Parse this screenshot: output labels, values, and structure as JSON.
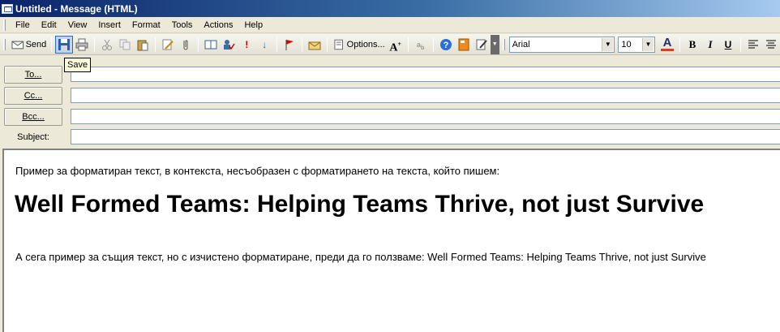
{
  "window": {
    "title": "Untitled - Message (HTML)"
  },
  "menu": [
    "File",
    "Edit",
    "View",
    "Insert",
    "Format",
    "Tools",
    "Actions",
    "Help"
  ],
  "toolbar": {
    "send_label": "Send",
    "options_label": "Options...",
    "font_name": "Arial",
    "font_size": "10",
    "bold": "B",
    "italic": "I",
    "underline": "U"
  },
  "tooltip": {
    "text": "Save"
  },
  "header": {
    "to_label": "To...",
    "cc_label": "Cc...",
    "bcc_label": "Bcc...",
    "subject_label": "Subject:",
    "to_value": "",
    "cc_value": "",
    "bcc_value": "",
    "subject_value": ""
  },
  "body": {
    "line1": "Пример за форматиран текст, в контекста, несъобразен с форматирането на текста, който пишем:",
    "heading": "Well Formed Teams: Helping Teams Thrive, not just Survive",
    "line2": "А сега пример за същия текст, но с изчистено форматиране, преди да го ползваме: Well Formed Teams: Helping Teams Thrive, not just Survive"
  },
  "colors": {
    "title_start": "#0a246a",
    "title_end": "#a6caf0",
    "chrome": "#ece9d8",
    "font_color_bar": "#e03b1c"
  }
}
